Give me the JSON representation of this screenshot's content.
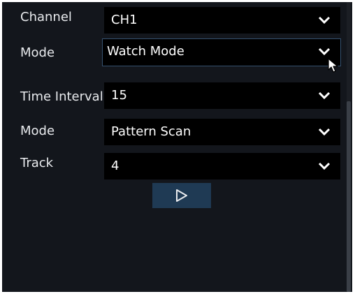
{
  "form": {
    "channel": {
      "label": "Channel",
      "value": "CH1"
    },
    "mode": {
      "label": "Mode",
      "value": "Watch Mode"
    },
    "time_interval": {
      "label": "Time Interval",
      "value": "15"
    },
    "scan_mode": {
      "label": "Mode",
      "value": "Pattern Scan"
    },
    "track": {
      "label": "Track",
      "value": "4"
    }
  },
  "icons": {
    "dropdown": "chevron-down-icon",
    "play": "play-icon",
    "cursor": "mouse-pointer-icon"
  },
  "colors": {
    "background": "#13161c",
    "field": "#000000",
    "text": "#ffffff",
    "button": "#1f3a54",
    "focus_border": "#35516f"
  }
}
